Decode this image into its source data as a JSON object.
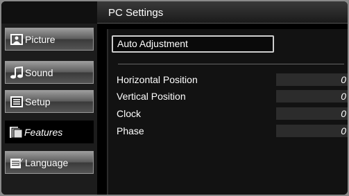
{
  "header": {
    "title": "PC Settings"
  },
  "menu": [
    {
      "label": "Picture",
      "icon": "picture-icon",
      "active": false
    },
    {
      "label": "Sound",
      "icon": "sound-icon",
      "active": false
    },
    {
      "label": "Setup",
      "icon": "setup-icon",
      "active": false
    },
    {
      "label": "Features",
      "icon": "features-icon",
      "active": true
    },
    {
      "label": "Language",
      "icon": "language-icon",
      "active": false
    }
  ],
  "main": {
    "auto_adjustment": "Auto Adjustment",
    "settings": [
      {
        "label": "Horizontal Position",
        "value": "0"
      },
      {
        "label": "Vertical Position",
        "value": "0"
      },
      {
        "label": "Clock",
        "value": "0"
      },
      {
        "label": "Phase",
        "value": "0"
      }
    ]
  },
  "colors": {
    "button_gradient_top": "#9c9c9c",
    "button_gradient_bottom": "#3a3a3a",
    "value_box": "#2c2c2c"
  }
}
